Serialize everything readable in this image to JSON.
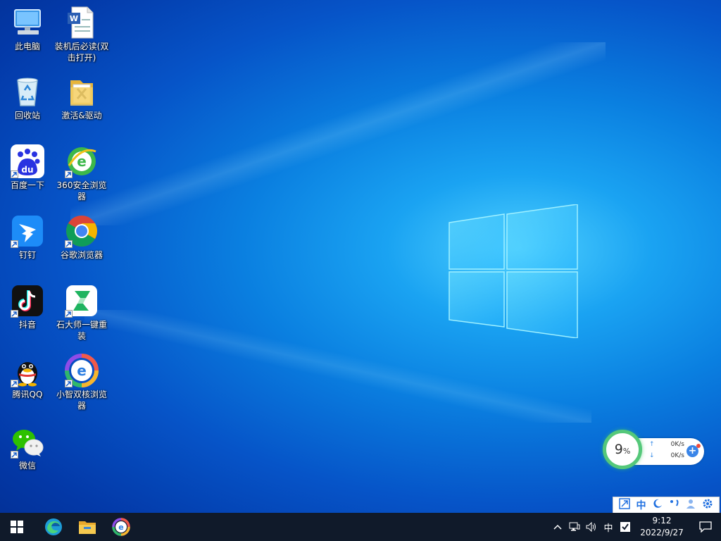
{
  "desktop": {
    "icons": [
      {
        "label": "此电脑",
        "icon": "computer-icon"
      },
      {
        "label": "装机后必读(双击打开)",
        "icon": "word-document-icon"
      },
      {
        "label": "回收站",
        "icon": "recycle-bin-icon"
      },
      {
        "label": "激活&驱动",
        "icon": "folder-icon"
      },
      {
        "label": "百度一下",
        "icon": "baidu-icon"
      },
      {
        "label": "360安全浏览器",
        "icon": "360-browser-icon"
      },
      {
        "label": "钉钉",
        "icon": "dingtalk-icon"
      },
      {
        "label": "谷歌浏览器",
        "icon": "chrome-icon"
      },
      {
        "label": "抖音",
        "icon": "douyin-icon"
      },
      {
        "label": "石大师一键重装",
        "icon": "shidashi-icon"
      },
      {
        "label": "腾讯QQ",
        "icon": "qq-icon"
      },
      {
        "label": "小智双核浏览器",
        "icon": "xiaozhi-browser-icon"
      },
      {
        "label": "微信",
        "icon": "wechat-icon"
      }
    ]
  },
  "widget": {
    "cpu_value": "9",
    "cpu_unit": "%",
    "upload": "0K/s",
    "download": "0K/s",
    "accent": "#55c87a"
  },
  "ime_bar": {
    "mode": "中",
    "items": [
      "arrow-icon",
      "中",
      "moon-icon",
      "punctuation-icon",
      "user-icon",
      "gear-icon"
    ]
  },
  "taskbar": {
    "apps": [
      "start-icon",
      "edge-icon",
      "file-explorer-icon",
      "xiaozhi-browser-icon"
    ],
    "tray": {
      "input_indicator": "中",
      "time": "9:12",
      "date": "2022/9/27"
    }
  },
  "colors": {
    "taskbar": "#101a2a",
    "accent_blue": "#1f6fe0"
  }
}
